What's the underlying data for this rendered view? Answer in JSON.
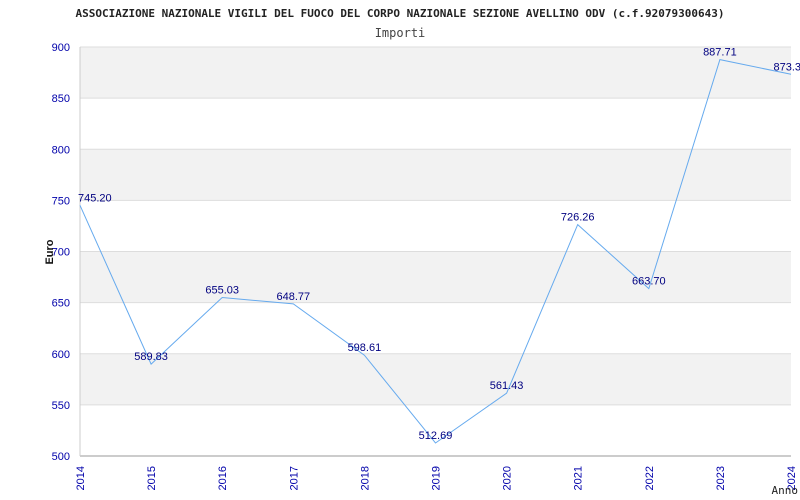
{
  "chart_data": {
    "type": "line",
    "title": "ASSOCIAZIONE NAZIONALE VIGILI DEL FUOCO DEL CORPO NAZIONALE SEZIONE AVELLINO ODV (c.f.92079300643)",
    "subtitle": "Importi",
    "xlabel": "Anno",
    "ylabel": "Euro",
    "x": [
      "2014",
      "2015",
      "2016",
      "2017",
      "2018",
      "2019",
      "2020",
      "2021",
      "2022",
      "2023",
      "2024"
    ],
    "series": [
      {
        "values": [
          745.2,
          589.83,
          655.03,
          648.77,
          598.61,
          512.69,
          561.43,
          726.26,
          663.7,
          887.71,
          873.3
        ]
      }
    ],
    "data_labels": [
      "745.20",
      "589.83",
      "655.03",
      "648.77",
      "598.61",
      "512.69",
      "561.43",
      "726.26",
      "663.70",
      "887.71",
      "873.3"
    ],
    "yticks": [
      "500",
      "550",
      "600",
      "650",
      "700",
      "750",
      "800",
      "850",
      "900"
    ],
    "ylim": [
      500,
      900
    ],
    "grid": true,
    "colors": {
      "line": "#66aaee",
      "band": "#f2f2f2",
      "tick_text": "#0000aa",
      "label_text": "#000080"
    }
  }
}
